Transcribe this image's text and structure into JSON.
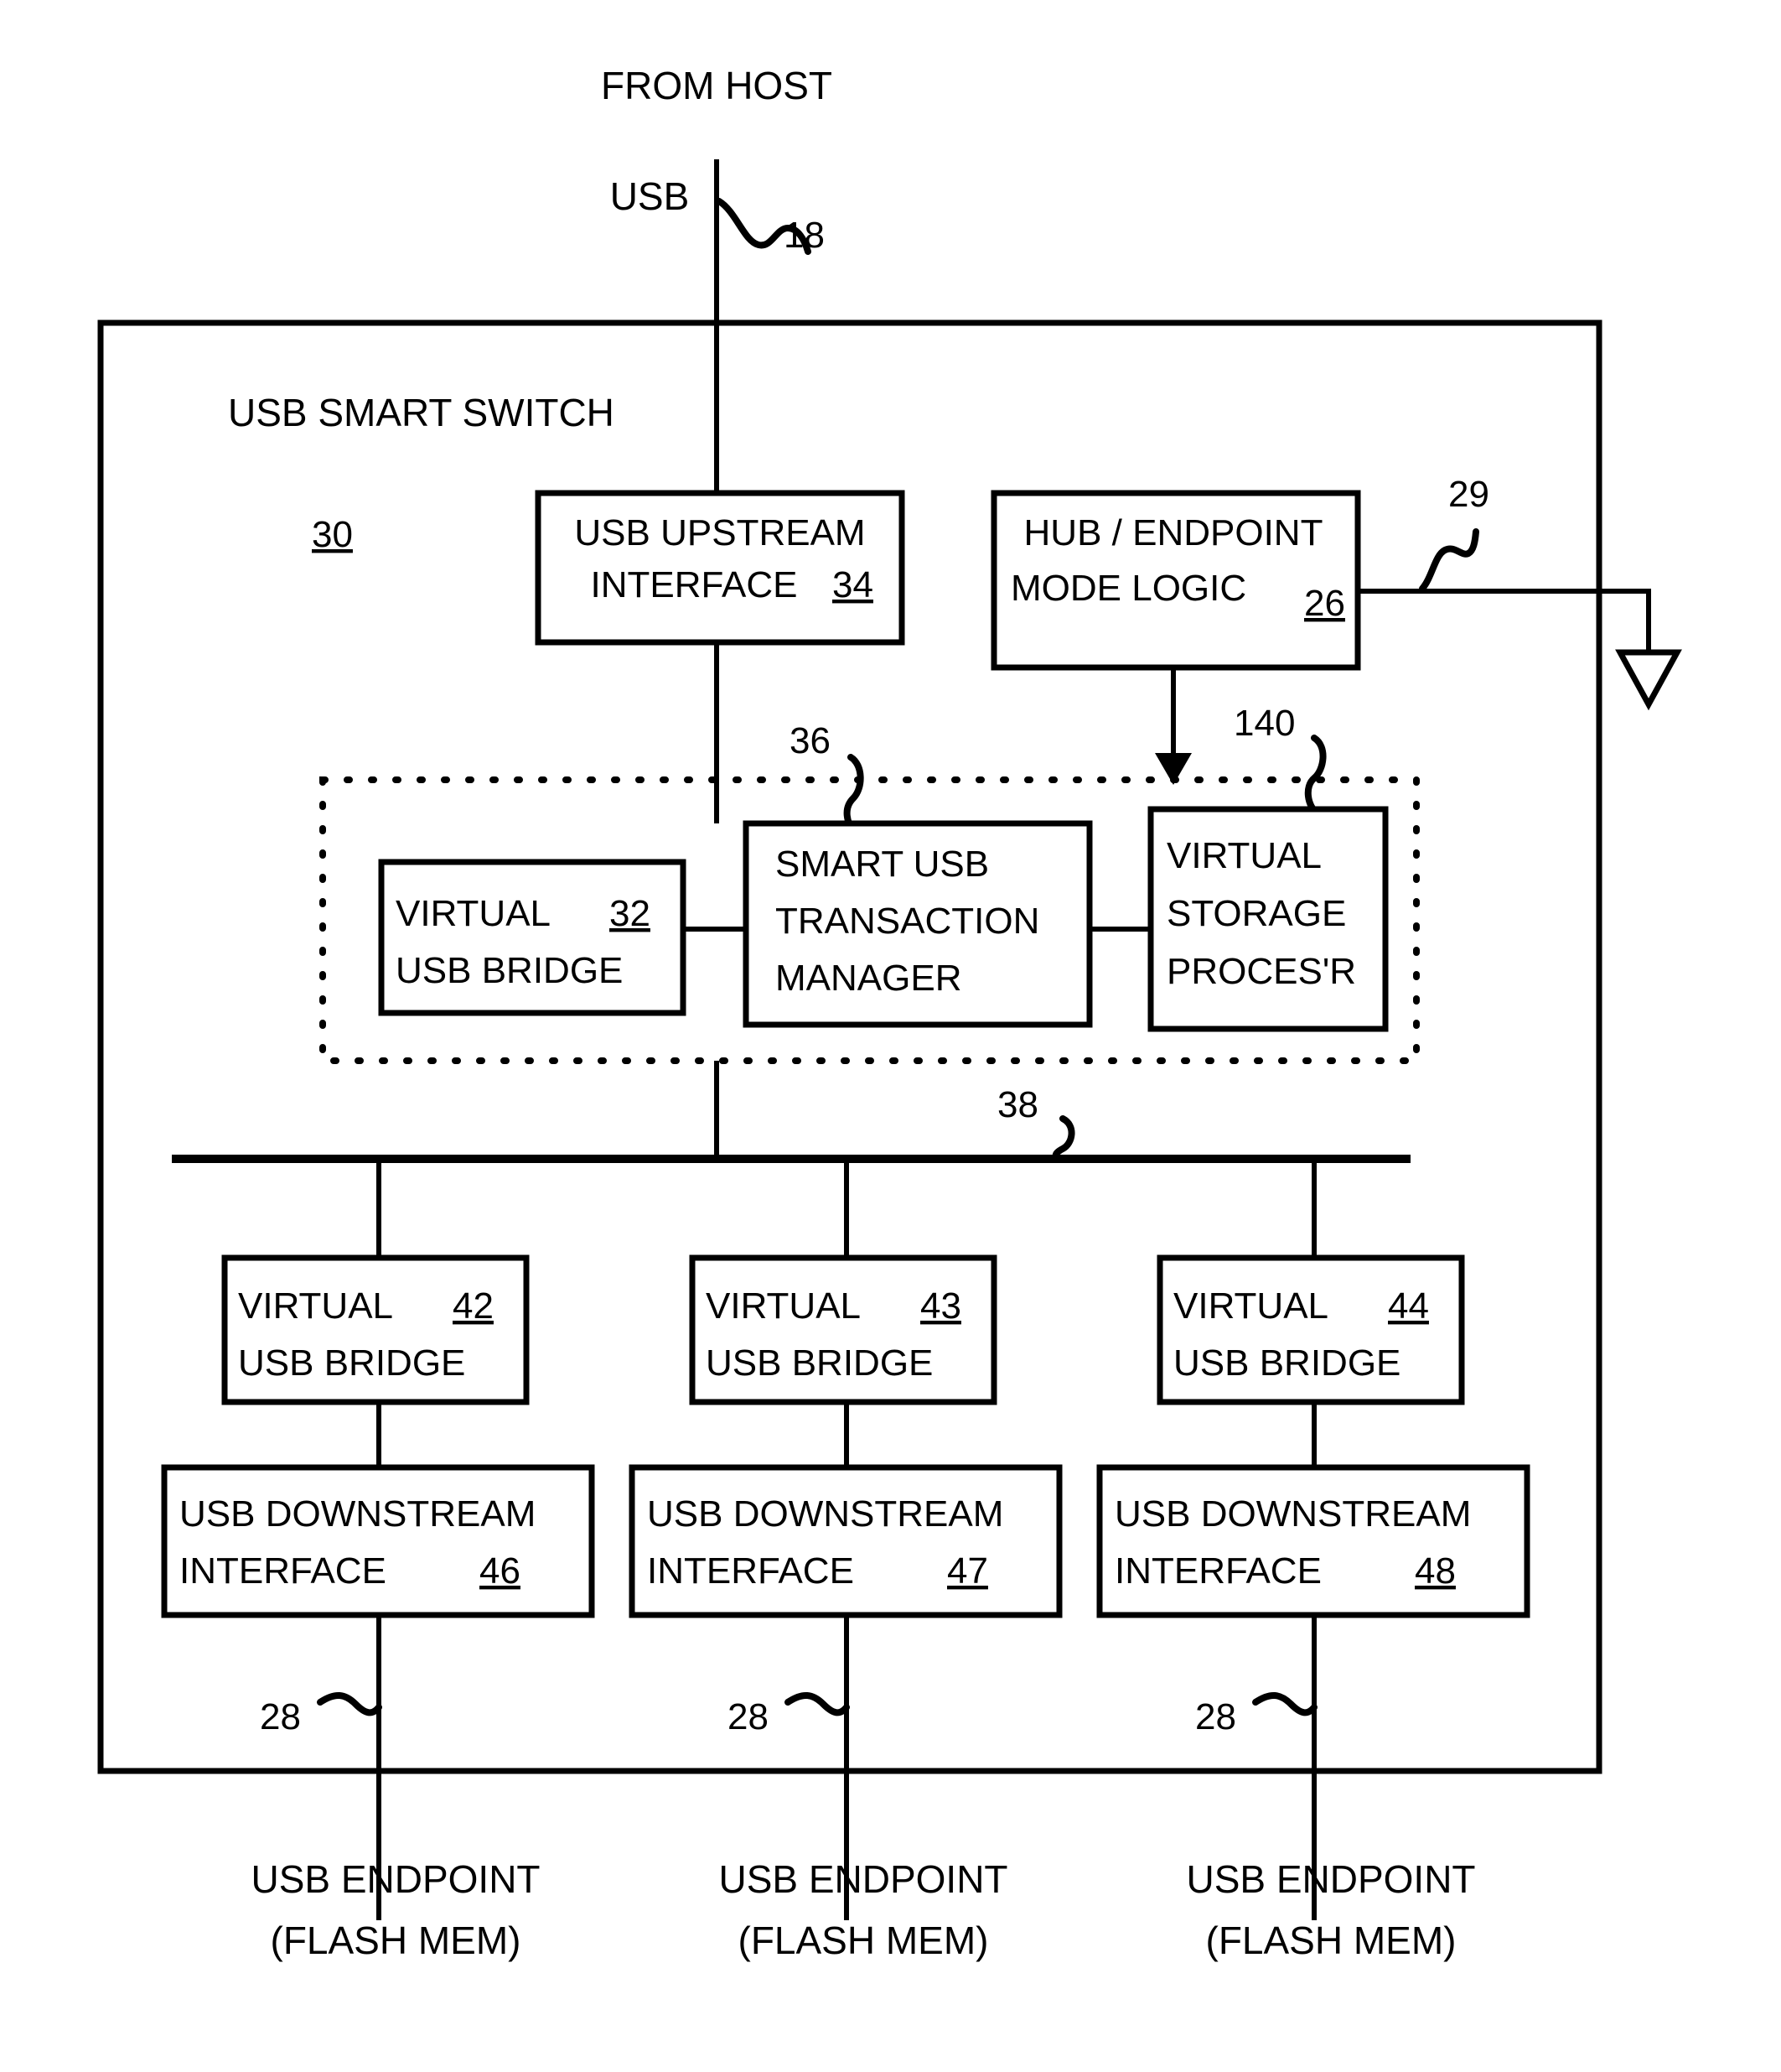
{
  "figure": {
    "title_top": "FROM HOST",
    "bus_label_usb": "USB",
    "container_label": "USB SMART SWITCH",
    "container_ref": "30"
  },
  "refs": {
    "host_link": "18",
    "mode_logic_out": "29",
    "smart_group": "36",
    "virtual_storage": "140",
    "internal_bus": "38",
    "downstream_link_1": "28",
    "downstream_link_2": "28",
    "downstream_link_3": "28"
  },
  "blocks": {
    "usb_upstream_interface": {
      "line1": "USB UPSTREAM",
      "line2": "INTERFACE",
      "ref": "34"
    },
    "hub_endpoint_mode_logic": {
      "line1": "HUB / ENDPOINT",
      "line2": "MODE LOGIC",
      "ref": "26"
    },
    "virtual_usb_bridge_main": {
      "line1": "VIRTUAL",
      "line2": "USB BRIDGE",
      "ref": "32"
    },
    "smart_usb_transaction_manager": {
      "line1": "SMART USB",
      "line2": "TRANSACTION",
      "line3": "MANAGER"
    },
    "virtual_storage_processor": {
      "line1": "VIRTUAL",
      "line2": "STORAGE",
      "line3": "PROCES'R"
    }
  },
  "columns": [
    {
      "bridge": {
        "line1": "VIRTUAL",
        "line2": "USB BRIDGE",
        "ref": "42"
      },
      "downstream": {
        "line1": "USB DOWNSTREAM",
        "line2": "INTERFACE",
        "ref": "46"
      },
      "link_ref": "28",
      "endpoint": {
        "line1": "USB ENDPOINT",
        "line2": "(FLASH MEM)"
      }
    },
    {
      "bridge": {
        "line1": "VIRTUAL",
        "line2": "USB BRIDGE",
        "ref": "43"
      },
      "downstream": {
        "line1": "USB DOWNSTREAM",
        "line2": "INTERFACE",
        "ref": "47"
      },
      "link_ref": "28",
      "endpoint": {
        "line1": "USB ENDPOINT",
        "line2": "(FLASH MEM)"
      }
    },
    {
      "bridge": {
        "line1": "VIRTUAL",
        "line2": "USB BRIDGE",
        "ref": "44"
      },
      "downstream": {
        "line1": "USB DOWNSTREAM",
        "line2": "INTERFACE",
        "ref": "48"
      },
      "link_ref": "28",
      "endpoint": {
        "line1": "USB ENDPOINT",
        "line2": "(FLASH MEM)"
      }
    }
  ],
  "colors": {
    "ink": "#000000",
    "paper": "#ffffff"
  }
}
